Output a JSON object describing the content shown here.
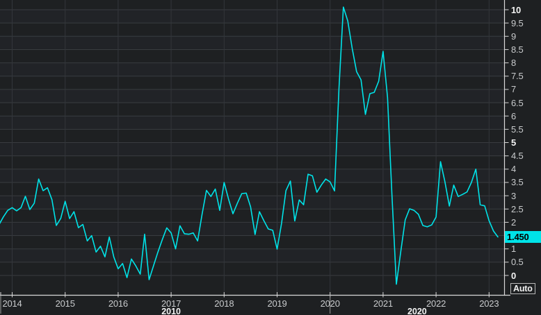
{
  "colors": {
    "background": "#1e2022",
    "row_band_alt": "#212327",
    "grid_horizontal": "#393c40",
    "grid_vertical": "#33363b",
    "axis": "#d9d9d9",
    "label": "#c9cbcd",
    "label_strong": "#f4f4f4",
    "line": "#00e3e8",
    "badge_bg": "#00e3e8",
    "badge_text": "#000000",
    "decade_divider": "#9b9b9b"
  },
  "controls": {
    "auto_button": "Auto"
  },
  "chart_data": {
    "type": "line",
    "title": "",
    "grid": true,
    "legend_position": "none",
    "last_value_label": "1.450",
    "last_value": 1.45,
    "y_axis": {
      "side": "right",
      "min": 0,
      "max": 10,
      "step": 0.5,
      "hidden_label_values": [
        1.5
      ],
      "ticks": [
        {
          "value": 10,
          "label": "10",
          "bold": true
        },
        {
          "value": 9.5,
          "label": "9.5",
          "bold": false
        },
        {
          "value": 9,
          "label": "9",
          "bold": false
        },
        {
          "value": 8.5,
          "label": "8.5",
          "bold": false
        },
        {
          "value": 8,
          "label": "8",
          "bold": false
        },
        {
          "value": 7.5,
          "label": "7.5",
          "bold": false
        },
        {
          "value": 7,
          "label": "7",
          "bold": false
        },
        {
          "value": 6.5,
          "label": "6.5",
          "bold": false
        },
        {
          "value": 6,
          "label": "6",
          "bold": false
        },
        {
          "value": 5.5,
          "label": "5.5",
          "bold": false
        },
        {
          "value": 5,
          "label": "5",
          "bold": true
        },
        {
          "value": 4.5,
          "label": "4.5",
          "bold": false
        },
        {
          "value": 4,
          "label": "4",
          "bold": false
        },
        {
          "value": 3.5,
          "label": "3.5",
          "bold": false
        },
        {
          "value": 3,
          "label": "3",
          "bold": false
        },
        {
          "value": 2.5,
          "label": "2.5",
          "bold": false
        },
        {
          "value": 2,
          "label": "2",
          "bold": false
        },
        {
          "value": 1,
          "label": "1",
          "bold": false
        },
        {
          "value": 0.5,
          "label": "0.5",
          "bold": false
        },
        {
          "value": 0,
          "label": "0",
          "bold": true
        }
      ]
    },
    "x_axis": {
      "years": [
        {
          "year": 2014,
          "label": "2014"
        },
        {
          "year": 2015,
          "label": "2015"
        },
        {
          "year": 2016,
          "label": "2016"
        },
        {
          "year": 2017,
          "label": "2017"
        },
        {
          "year": 2018,
          "label": "2018"
        },
        {
          "year": 2019,
          "label": "2019"
        },
        {
          "year": 2020,
          "label": "2020"
        },
        {
          "year": 2021,
          "label": "2021"
        },
        {
          "year": 2022,
          "label": "2022"
        },
        {
          "year": 2023,
          "label": "2023"
        }
      ],
      "decades": [
        {
          "label": "2010",
          "span_years": [
            2014,
            2020
          ]
        },
        {
          "label": "2020",
          "span_years": [
            2020,
            2023.3
          ]
        }
      ]
    },
    "series": [
      {
        "name": "value-line",
        "color": "#00e3e8",
        "dates": [
          "2013-10",
          "2013-11",
          "2013-12",
          "2014-01",
          "2014-02",
          "2014-03",
          "2014-04",
          "2014-05",
          "2014-06",
          "2014-07",
          "2014-08",
          "2014-09",
          "2014-10",
          "2014-11",
          "2014-12",
          "2015-01",
          "2015-02",
          "2015-03",
          "2015-04",
          "2015-05",
          "2015-06",
          "2015-07",
          "2015-08",
          "2015-09",
          "2015-10",
          "2015-11",
          "2015-12",
          "2016-01",
          "2016-02",
          "2016-03",
          "2016-04",
          "2016-05",
          "2016-06",
          "2016-07",
          "2016-08",
          "2016-09",
          "2016-10",
          "2016-11",
          "2016-12",
          "2017-01",
          "2017-02",
          "2017-03",
          "2017-04",
          "2017-05",
          "2017-06",
          "2017-07",
          "2017-08",
          "2017-09",
          "2017-10",
          "2017-11",
          "2017-12",
          "2018-01",
          "2018-02",
          "2018-03",
          "2018-04",
          "2018-05",
          "2018-06",
          "2018-07",
          "2018-08",
          "2018-09",
          "2018-10",
          "2018-11",
          "2018-12",
          "2019-01",
          "2019-02",
          "2019-03",
          "2019-04",
          "2019-05",
          "2019-06",
          "2019-07",
          "2019-08",
          "2019-09",
          "2019-10",
          "2019-11",
          "2019-12",
          "2020-01",
          "2020-02",
          "2020-03",
          "2020-04",
          "2020-05",
          "2020-06",
          "2020-07",
          "2020-08",
          "2020-09",
          "2020-10",
          "2020-11",
          "2020-12",
          "2021-01",
          "2021-02",
          "2021-03",
          "2021-04",
          "2021-05",
          "2021-06",
          "2021-07",
          "2021-08",
          "2021-09",
          "2021-10",
          "2021-11",
          "2021-12",
          "2022-01",
          "2022-02",
          "2022-03",
          "2022-04",
          "2022-05",
          "2022-06",
          "2022-07",
          "2022-08",
          "2022-09",
          "2022-10",
          "2022-11",
          "2022-12",
          "2023-01",
          "2023-02",
          "2023-03"
        ],
        "values": [
          1.9,
          2.2,
          2.45,
          2.55,
          2.43,
          2.55,
          2.98,
          2.48,
          2.72,
          3.63,
          3.19,
          3.3,
          2.85,
          1.88,
          2.15,
          2.79,
          2.14,
          2.4,
          1.8,
          1.92,
          1.3,
          1.5,
          0.88,
          1.1,
          0.7,
          1.45,
          0.7,
          0.25,
          0.45,
          -0.08,
          0.62,
          0.36,
          0.05,
          1.55,
          -0.16,
          0.36,
          0.88,
          1.35,
          1.79,
          1.6,
          1.0,
          1.87,
          1.57,
          1.55,
          1.6,
          1.3,
          2.3,
          3.2,
          2.97,
          3.25,
          2.45,
          3.5,
          2.87,
          2.32,
          2.72,
          3.08,
          3.1,
          2.58,
          1.54,
          2.4,
          2.06,
          1.75,
          1.7,
          0.99,
          1.96,
          3.19,
          3.55,
          2.05,
          2.84,
          2.66,
          3.81,
          3.75,
          3.13,
          3.4,
          3.63,
          3.52,
          3.18,
          7.0,
          10.1,
          9.58,
          8.54,
          7.67,
          7.36,
          6.06,
          6.84,
          6.89,
          7.31,
          8.43,
          6.7,
          3.05,
          -0.33,
          0.89,
          2.09,
          2.51,
          2.45,
          2.3,
          1.88,
          1.83,
          1.9,
          2.2,
          4.28,
          3.53,
          2.61,
          3.4,
          2.97,
          3.05,
          3.14,
          3.5,
          4.0,
          2.66,
          2.62,
          2.06,
          1.67,
          1.45
        ]
      }
    ]
  }
}
